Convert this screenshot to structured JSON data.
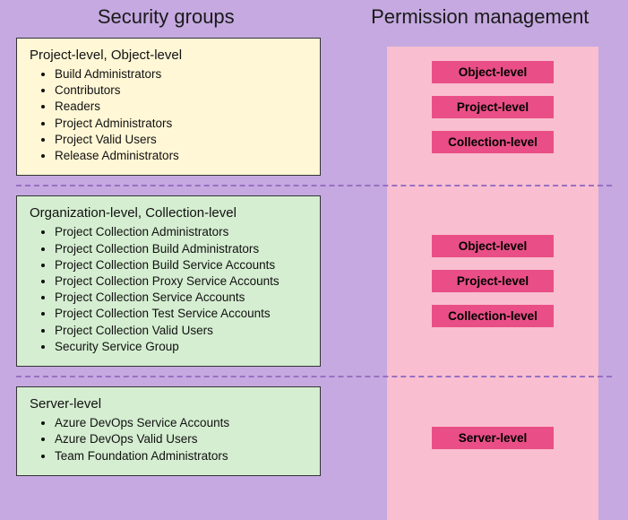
{
  "headers": {
    "security_groups": "Security groups",
    "permission_management": "Permission management"
  },
  "sections": [
    {
      "box_color": "yellow",
      "title": "Project-level, Object-level",
      "items": [
        "Build Administrators",
        "Contributors",
        "Readers",
        "Project Administrators",
        "Project Valid Users",
        "Release Administrators"
      ],
      "permissions": [
        "Object-level",
        "Project-level",
        "Collection-level"
      ]
    },
    {
      "box_color": "green",
      "title": "Organization-level, Collection-level",
      "items": [
        "Project Collection Administrators",
        "Project Collection Build Administrators",
        "Project Collection Build Service Accounts",
        "Project Collection Proxy Service Accounts",
        "Project Collection Service Accounts",
        "Project Collection Test Service Accounts",
        "Project Collection Valid Users",
        "Security Service Group"
      ],
      "permissions": [
        "Object-level",
        "Project-level",
        "Collection-level"
      ]
    },
    {
      "box_color": "green",
      "title": "Server-level",
      "items": [
        "Azure DevOps Service Accounts",
        "Azure DevOps Valid Users",
        "Team Foundation Administrators"
      ],
      "permissions": [
        "Server-level"
      ]
    }
  ]
}
